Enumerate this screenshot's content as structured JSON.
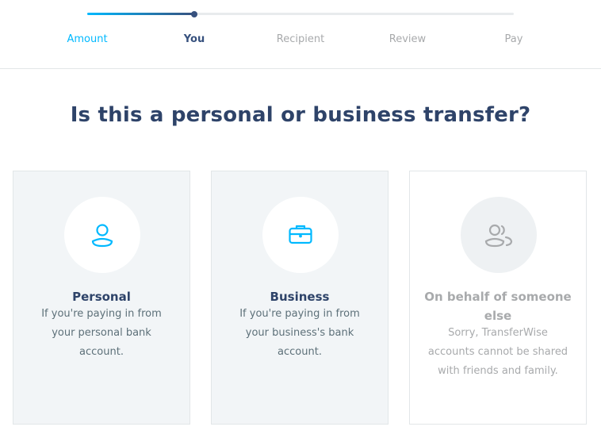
{
  "progress": {
    "completed_fraction": 0.25,
    "steps": [
      {
        "label": "Amount",
        "state": "done"
      },
      {
        "label": "You",
        "state": "active"
      },
      {
        "label": "Recipient",
        "state": "upcoming"
      },
      {
        "label": "Review",
        "state": "upcoming"
      },
      {
        "label": "Pay",
        "state": "upcoming"
      }
    ]
  },
  "heading": "Is this a personal or business transfer?",
  "options": [
    {
      "title": "Personal",
      "description": "If you're paying in from your personal bank account.",
      "icon": "person-icon",
      "enabled": true
    },
    {
      "title": "Business",
      "description": "If you're paying in from your business's bank account.",
      "icon": "briefcase-icon",
      "enabled": true
    },
    {
      "title": "On behalf of someone else",
      "description": "Sorry, TransferWise accounts cannot be shared with friends and family.",
      "icon": "people-icon",
      "enabled": false
    }
  ],
  "colors": {
    "accent": "#00b9ff",
    "navy": "#2e4369",
    "muted": "#a8aaac",
    "card_bg": "#f2f5f7"
  }
}
